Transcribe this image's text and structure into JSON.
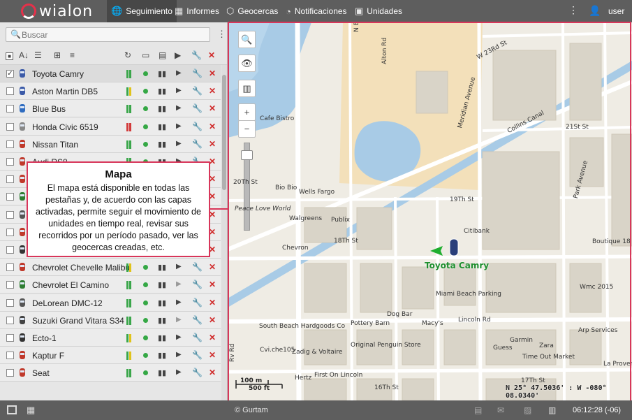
{
  "app": {
    "logo_text": "wialon"
  },
  "nav": {
    "tabs": [
      {
        "label": "Seguimiento",
        "icon": "globe-icon"
      },
      {
        "label": "Informes",
        "icon": "reports-icon"
      },
      {
        "label": "Geocercas",
        "icon": "geofence-icon"
      },
      {
        "label": "Notificaciones",
        "icon": "bell-icon"
      },
      {
        "label": "Unidades",
        "icon": "bus-icon"
      }
    ],
    "active_tab": "Seguimiento",
    "user": "user"
  },
  "search": {
    "placeholder": "Buscar"
  },
  "units": [
    {
      "name": "Toyota Camry",
      "checked": true,
      "color": "#3b5aa8",
      "signal": "green"
    },
    {
      "name": "Aston Martin DB5",
      "checked": false,
      "color": "#3b5aa8",
      "signal": "yellow"
    },
    {
      "name": "Blue Bus",
      "checked": false,
      "color": "#2f6cc0",
      "signal": "green"
    },
    {
      "name": "Honda Civic 6519",
      "checked": false,
      "color": "#888888",
      "signal": "red"
    },
    {
      "name": "Nissan Titan",
      "checked": false,
      "color": "#c0392b",
      "signal": "green"
    },
    {
      "name": "Audi RS8",
      "checked": false,
      "color": "#c0392b",
      "signal": "green"
    },
    {
      "name": "",
      "checked": false,
      "color": "#c0392b",
      "signal": "green"
    },
    {
      "name": "",
      "checked": false,
      "color": "#2e7d32",
      "signal": "green"
    },
    {
      "name": "",
      "checked": false,
      "color": "#555555",
      "signal": "green"
    },
    {
      "name": "",
      "checked": false,
      "color": "#c0392b",
      "signal": "green"
    },
    {
      "name": "Bullitt's Mustang",
      "checked": false,
      "color": "#333333",
      "signal": "yellow"
    },
    {
      "name": "Chevrolet Chevelle Malibu",
      "checked": false,
      "color": "#c0392b",
      "signal": "yellow"
    },
    {
      "name": "Chevrolet El Camino",
      "checked": false,
      "color": "#2e7d32",
      "signal": "green"
    },
    {
      "name": "DeLorean DMC-12",
      "checked": false,
      "color": "#555555",
      "signal": "green"
    },
    {
      "name": "Suzuki Grand Vitara S34",
      "checked": false,
      "color": "#444444",
      "signal": "green"
    },
    {
      "name": "Ecto-1",
      "checked": false,
      "color": "#333333",
      "signal": "yellow"
    },
    {
      "name": "Kaptur F",
      "checked": false,
      "color": "#c0392b",
      "signal": "yellow"
    },
    {
      "name": "Seat",
      "checked": false,
      "color": "#c0392b",
      "signal": "green"
    }
  ],
  "callout": {
    "title": "Mapa",
    "body": "El mapa está disponible en todas las pestañas y, de acuerdo con las capas activadas, permite seguir el movimiento de unidades en tiempo real, revisar sus recorridos por un período pasado, ver las geocercas creadas, etc."
  },
  "map": {
    "unit_label": "Toyota Camry",
    "coords": "N 25° 47.5036' : W -080° 08.0340'",
    "scale_metric": "100 m",
    "scale_imperial": "500 ft",
    "labels": [
      "N Bay Rd",
      "Alton Rd",
      "W 23Rd St",
      "Meridian Avenue",
      "Collins Canal",
      "21St St",
      "Park Avenue",
      "Cafe Bistro",
      "Bio Bio",
      "Wells Fargo",
      "20Th St",
      "Peace Love World",
      "Walgreens",
      "Publix",
      "19Th St",
      "Citibank",
      "18Th St",
      "Chevron",
      "Boutique 18",
      "Miami Beach Parking",
      "Wmc 2015",
      "Dog Bar",
      "South Beach Hardgoods Co",
      "Pottery Barn",
      "Macy's",
      "Lincoln Rd",
      "Cvi.che105",
      "Zadig & Voltaire",
      "Original Penguin Store",
      "Guess",
      "Garmin",
      "Zara",
      "Arp Services",
      "Time Out Market",
      "Hertz",
      "First On Lincoln",
      "La Provence",
      "16Th St",
      "17Th St",
      "Rv Rd"
    ]
  },
  "footer": {
    "copyright": "© Gurtam",
    "time": "06:12:28 (-06)"
  }
}
